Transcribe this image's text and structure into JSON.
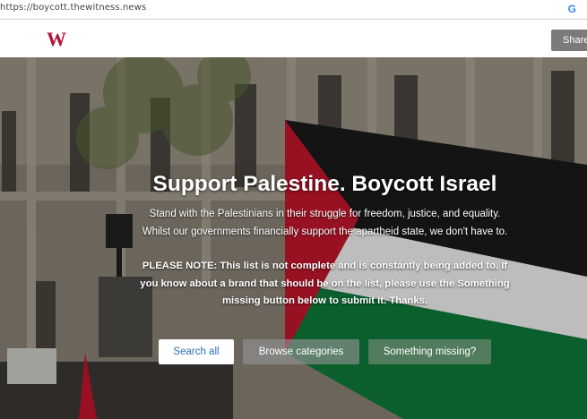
{
  "browser": {
    "url": "https://boycott.thewitness.news",
    "search_engine_glyph": "G"
  },
  "header": {
    "logo": "W",
    "share_label": "Share",
    "logo_color": "#b3143a"
  },
  "hero": {
    "title": "Support Palestine. Boycott Israel",
    "description": "Stand with the Palestinians in their struggle for freedom, justice, and equality. Whilst our governments financially support the apartheid state, we don't have to.",
    "note": "PLEASE NOTE: This list is not complete and is constantly being added to. If you know about a brand that should be on the list, please use the Something missing button below to submit it. Thanks.",
    "buttons": {
      "search_all": "Search all",
      "browse_categories": "Browse categories",
      "something_missing": "Something missing?"
    },
    "flag_colors": [
      "#c8102e",
      "#ffffff",
      "#007a3d",
      "#000000"
    ]
  }
}
